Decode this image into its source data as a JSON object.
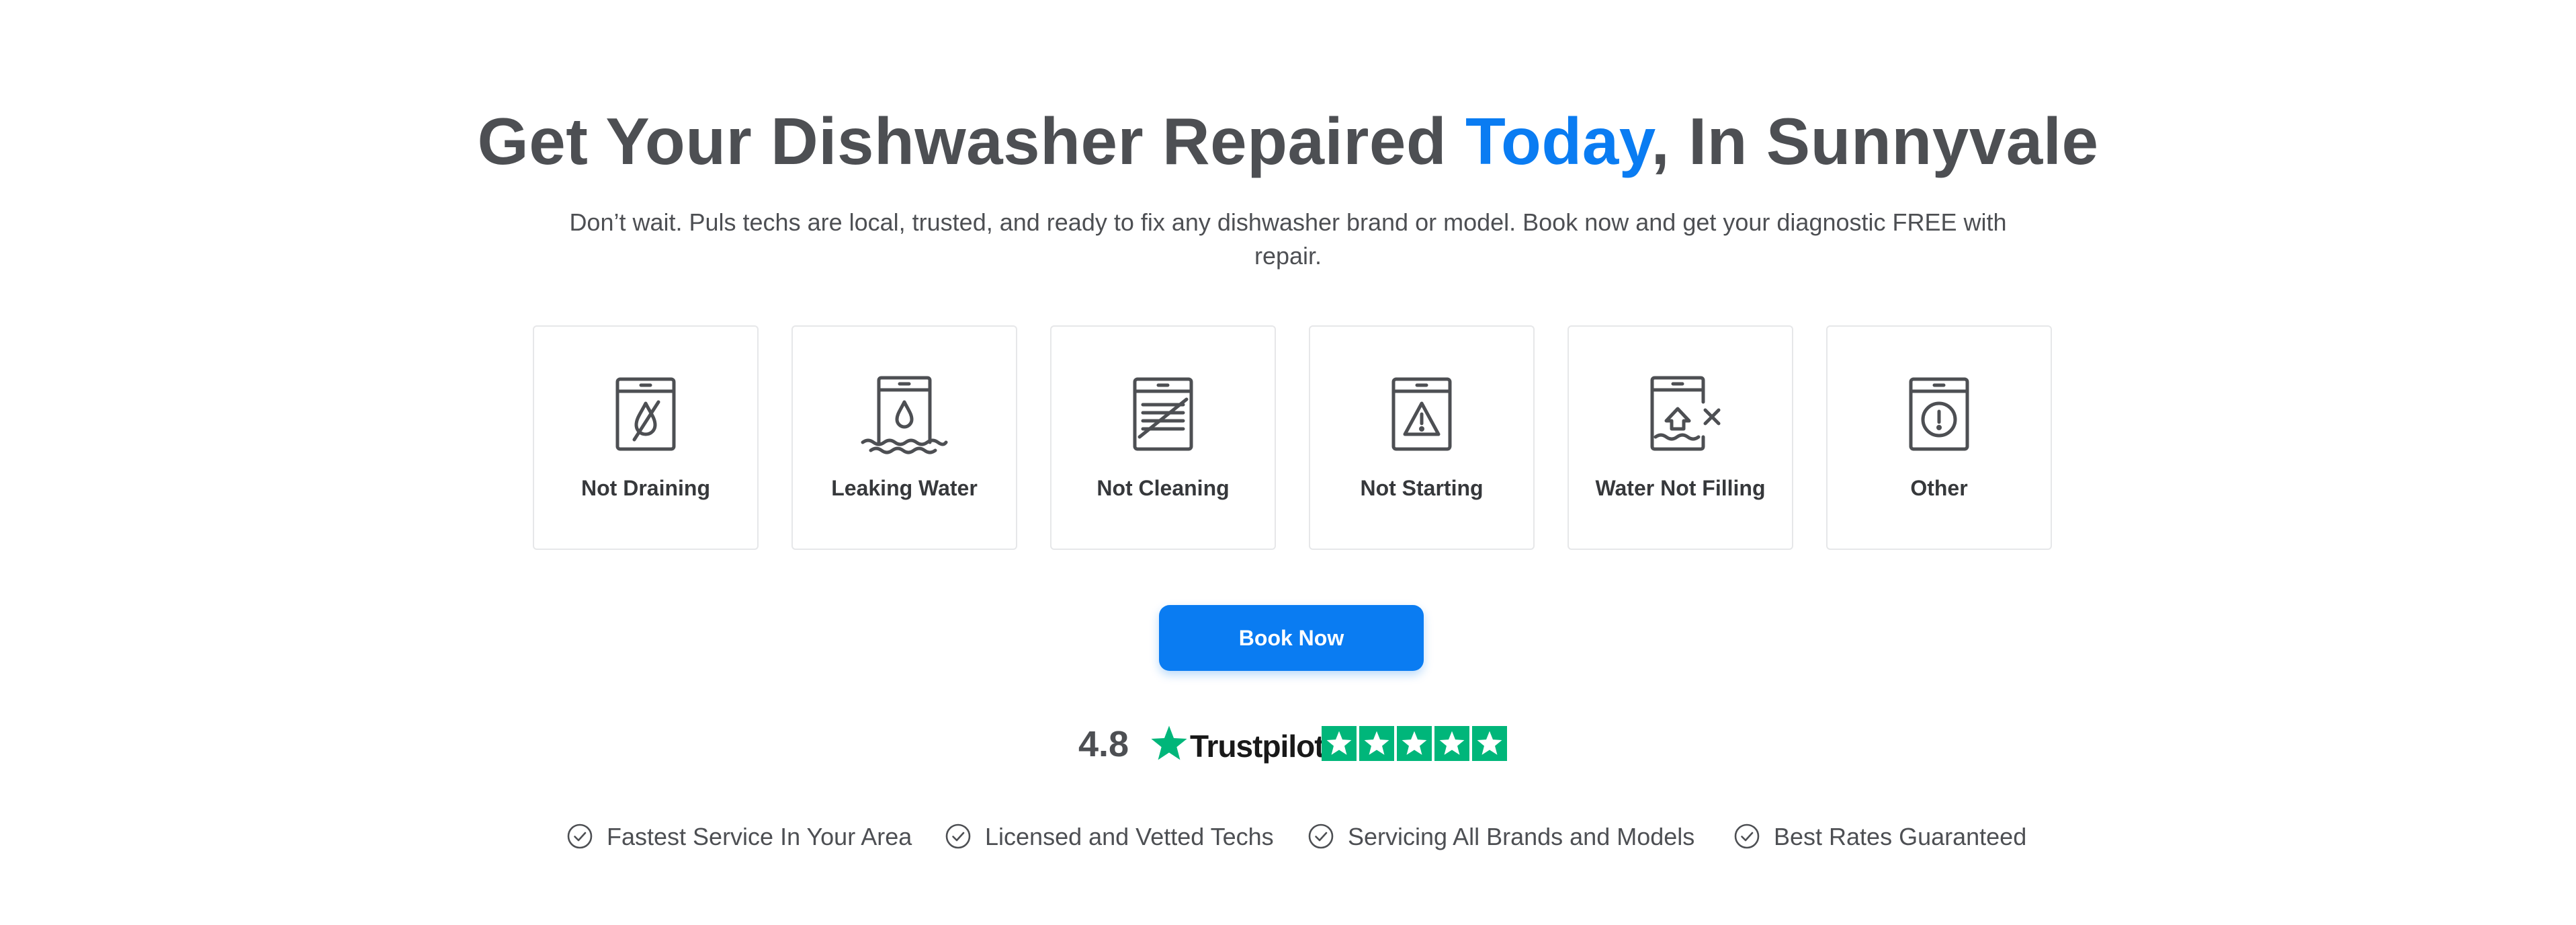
{
  "hero": {
    "title_before": "Get Your Dishwasher Repaired ",
    "title_accent": "Today",
    "title_after": ", In Sunnyvale",
    "subtitle": "Don’t wait. Puls techs are local, trusted, and ready to fix any dishwasher brand or model. Book now and get your diagnostic FREE with repair."
  },
  "colors": {
    "accent": "#0a7cf2",
    "text": "#4d4f53",
    "trustpilot_green": "#00b67a",
    "card_border": "#e6e7e9"
  },
  "issues": [
    {
      "label": "Not Draining",
      "icon": "dishwasher-no-drain-icon"
    },
    {
      "label": "Leaking Water",
      "icon": "dishwasher-leak-icon"
    },
    {
      "label": "Not Cleaning",
      "icon": "dishwasher-dirty-dishes-icon"
    },
    {
      "label": "Not Starting",
      "icon": "dishwasher-warning-icon"
    },
    {
      "label": "Water Not Filling",
      "icon": "dishwasher-no-fill-icon"
    },
    {
      "label": "Other",
      "icon": "dishwasher-exclamation-icon"
    }
  ],
  "cta": {
    "book_label": "Book Now"
  },
  "rating": {
    "score": "4.8",
    "provider": "Trustpilot",
    "stars": 5
  },
  "features": [
    {
      "text": "Fastest Service In Your Area",
      "icon": "check-circle-icon"
    },
    {
      "text": "Licensed and Vetted Techs",
      "icon": "check-circle-icon"
    },
    {
      "text": "Servicing All Brands and Models",
      "icon": "check-circle-icon"
    },
    {
      "text": "Best Rates Guaranteed",
      "icon": "check-circle-icon"
    }
  ]
}
